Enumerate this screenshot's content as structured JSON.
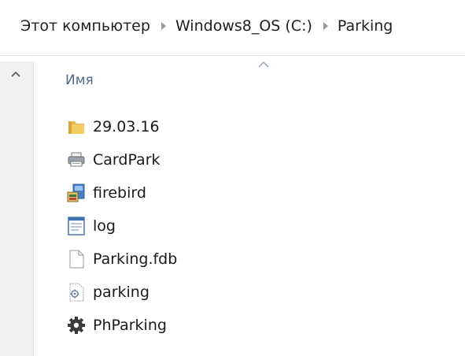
{
  "breadcrumb": {
    "items": [
      "Этот компьютер",
      "Windows8_OS (C:)",
      "Parking"
    ]
  },
  "column_header": {
    "name_label": "Имя"
  },
  "files": [
    {
      "name": "29.03.16",
      "icon": "folder-icon"
    },
    {
      "name": "CardPark",
      "icon": "printer-icon"
    },
    {
      "name": "firebird",
      "icon": "installer-icon"
    },
    {
      "name": "log",
      "icon": "text-document-icon"
    },
    {
      "name": "Parking.fdb",
      "icon": "blank-file-icon"
    },
    {
      "name": "parking",
      "icon": "config-file-icon"
    },
    {
      "name": "PhParking",
      "icon": "gear-icon"
    }
  ],
  "colors": {
    "header_text": "#4e6a8e",
    "folder": "#e8b64a",
    "nav_pane": "#f0f0f0"
  }
}
